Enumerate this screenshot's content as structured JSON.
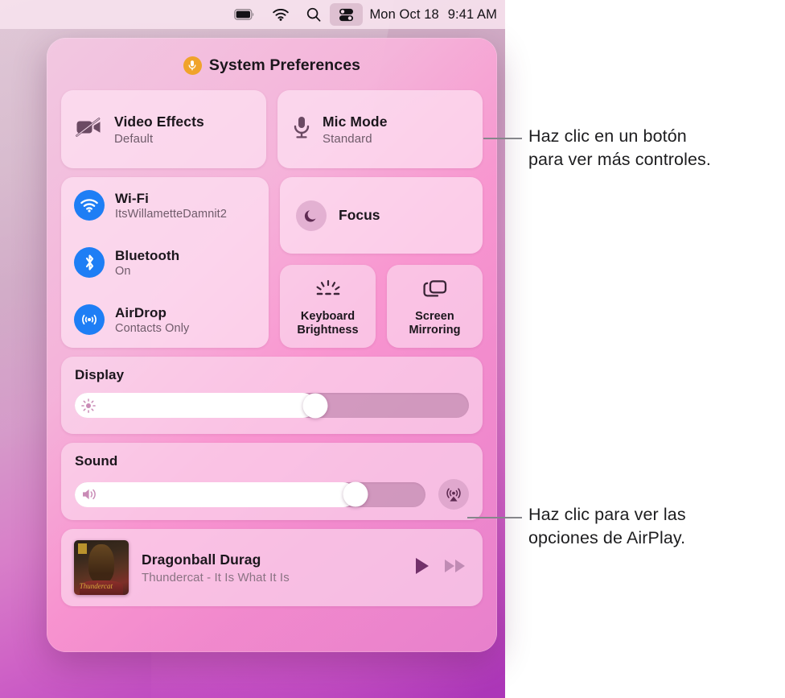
{
  "menubar": {
    "icons": [
      {
        "name": "battery-icon",
        "label": "Battery"
      },
      {
        "name": "wifi-icon",
        "label": "Wi-Fi"
      },
      {
        "name": "search-icon",
        "label": "Spotlight Search"
      },
      {
        "name": "control-center-icon",
        "label": "Control Center",
        "active": true
      }
    ],
    "date": "Mon Oct 18",
    "time": "9:41 AM"
  },
  "control_center": {
    "header": {
      "title": "System Preferences",
      "badge_icon": "microphone-in-use-icon",
      "badge_color": "#f0a32b"
    },
    "effects": [
      {
        "name": "video-effects",
        "icon": "video-off-icon",
        "title": "Video Effects",
        "subtitle": "Default"
      },
      {
        "name": "mic-mode",
        "icon": "microphone-icon",
        "title": "Mic Mode",
        "subtitle": "Standard"
      }
    ],
    "connectivity": [
      {
        "name": "wifi",
        "icon": "wifi-icon",
        "title": "Wi-Fi",
        "subtitle": "ItsWillametteDamnit2",
        "accent": "#1e7ef5"
      },
      {
        "name": "bluetooth",
        "icon": "bluetooth-icon",
        "title": "Bluetooth",
        "subtitle": "On",
        "accent": "#1e7ef5"
      },
      {
        "name": "airdrop",
        "icon": "airdrop-icon",
        "title": "AirDrop",
        "subtitle": "Contacts Only",
        "accent": "#1e7ef5"
      }
    ],
    "focus": {
      "icon": "moon-icon",
      "label": "Focus"
    },
    "small_tiles": [
      {
        "name": "keyboard-brightness",
        "icon": "keyboard-brightness-icon",
        "line1": "Keyboard",
        "line2": "Brightness"
      },
      {
        "name": "screen-mirroring",
        "icon": "screen-mirroring-icon",
        "line1": "Screen",
        "line2": "Mirroring"
      }
    ],
    "display": {
      "title": "Display",
      "icon": "brightness-icon",
      "value": 61
    },
    "sound": {
      "title": "Sound",
      "icon": "speaker-icon",
      "value": 80,
      "airplay_icon": "airplay-audio-icon"
    },
    "now_playing": {
      "track": "Dragonball Durag",
      "artist_album": "Thundercat - It Is What It Is",
      "album_art_signature": "Thundercat",
      "controls": [
        {
          "name": "play-button",
          "icon": "play-icon"
        },
        {
          "name": "fast-forward-button",
          "icon": "fast-forward-icon"
        }
      ]
    }
  },
  "callouts": [
    {
      "name": "callout-buttons",
      "line1": "Haz clic en un botón",
      "line2": "para ver más controles."
    },
    {
      "name": "callout-airplay",
      "line1": "Haz clic para ver las",
      "line2": "opciones de AirPlay."
    }
  ]
}
